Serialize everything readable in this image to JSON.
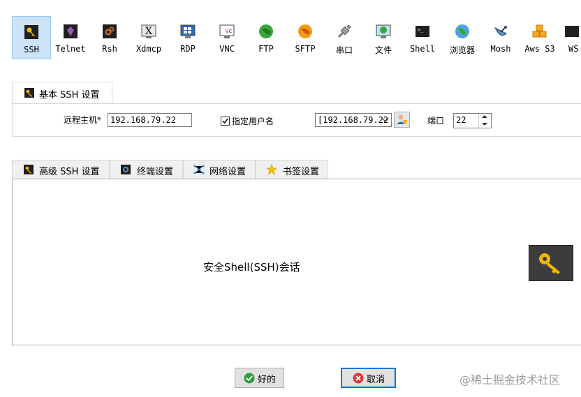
{
  "toolbar": {
    "items": [
      {
        "label": "SSH",
        "icon": "key-icon",
        "active": true
      },
      {
        "label": "Telnet",
        "icon": "telnet-icon"
      },
      {
        "label": "Rsh",
        "icon": "rsh-icon"
      },
      {
        "label": "Xdmcp",
        "icon": "xdmcp-icon"
      },
      {
        "label": "RDP",
        "icon": "rdp-icon"
      },
      {
        "label": "VNC",
        "icon": "vnc-icon"
      },
      {
        "label": "FTP",
        "icon": "ftp-globe-icon"
      },
      {
        "label": "SFTP",
        "icon": "sftp-globe-icon"
      },
      {
        "label": "串口",
        "icon": "serial-plug-icon"
      },
      {
        "label": "文件",
        "icon": "file-monitor-icon"
      },
      {
        "label": "Shell",
        "icon": "shell-terminal-icon"
      },
      {
        "label": "浏览器",
        "icon": "browser-globe-icon"
      },
      {
        "label": "Mosh",
        "icon": "mosh-satellite-icon"
      },
      {
        "label": "Aws S3",
        "icon": "aws-cubes-icon"
      },
      {
        "label": "WS",
        "icon": "ws-icon"
      }
    ]
  },
  "basic_tab": {
    "label": "基本 SSH 设置"
  },
  "form": {
    "remote_host_label": "远程主机*",
    "remote_host_value": "192.168.79.22",
    "specify_user_label": "指定用户名",
    "specify_user_checked": true,
    "username_value": "[192.168.79.22",
    "port_label": "端口",
    "port_value": "22"
  },
  "sub_tabs": [
    {
      "label": "高级 SSH 设置",
      "icon": "wrench-icon"
    },
    {
      "label": "终端设置",
      "icon": "terminal-settings-icon"
    },
    {
      "label": "网络设置",
      "icon": "network-icon"
    },
    {
      "label": "书签设置",
      "icon": "star-icon"
    }
  ],
  "panel": {
    "description": "安全Shell(SSH)会话"
  },
  "buttons": {
    "ok": "好的",
    "cancel": "取消"
  },
  "watermark": "@稀土掘金技术社区"
}
